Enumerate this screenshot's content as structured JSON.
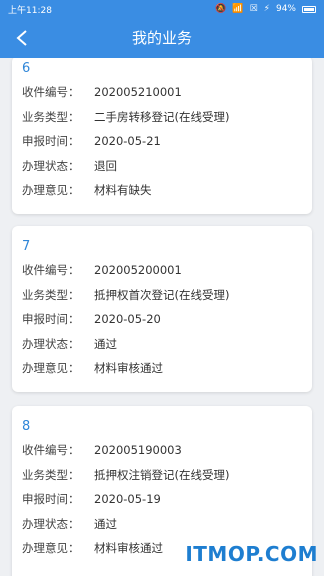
{
  "status_bar": {
    "time": "上午11:28",
    "battery": "94%"
  },
  "nav": {
    "title": "我的业务"
  },
  "records": [
    {
      "index": "6",
      "fields": [
        {
          "label": "收件编号：",
          "value": "202005210001"
        },
        {
          "label": "业务类型：",
          "value": "二手房转移登记(在线受理)"
        },
        {
          "label": "申报时间：",
          "value": "2020-05-21"
        },
        {
          "label": "办理状态：",
          "value": "退回"
        },
        {
          "label": "办理意见：",
          "value": "材料有缺失"
        }
      ]
    },
    {
      "index": "7",
      "fields": [
        {
          "label": "收件编号：",
          "value": "202005200001"
        },
        {
          "label": "业务类型：",
          "value": "抵押权首次登记(在线受理)"
        },
        {
          "label": "申报时间：",
          "value": "2020-05-20"
        },
        {
          "label": "办理状态：",
          "value": "通过"
        },
        {
          "label": "办理意见：",
          "value": "材料审核通过"
        }
      ]
    },
    {
      "index": "8",
      "fields": [
        {
          "label": "收件编号：",
          "value": "202005190003"
        },
        {
          "label": "业务类型：",
          "value": "抵押权注销登记(在线受理)"
        },
        {
          "label": "申报时间：",
          "value": "2020-05-19"
        },
        {
          "label": "办理状态：",
          "value": "通过"
        },
        {
          "label": "办理意见：",
          "value": "材料审核通过"
        }
      ]
    }
  ],
  "watermark": "ITMOP.COM",
  "colors": {
    "primary": "#3a8de3",
    "index": "#2f86d8",
    "background": "#eef0f3"
  }
}
